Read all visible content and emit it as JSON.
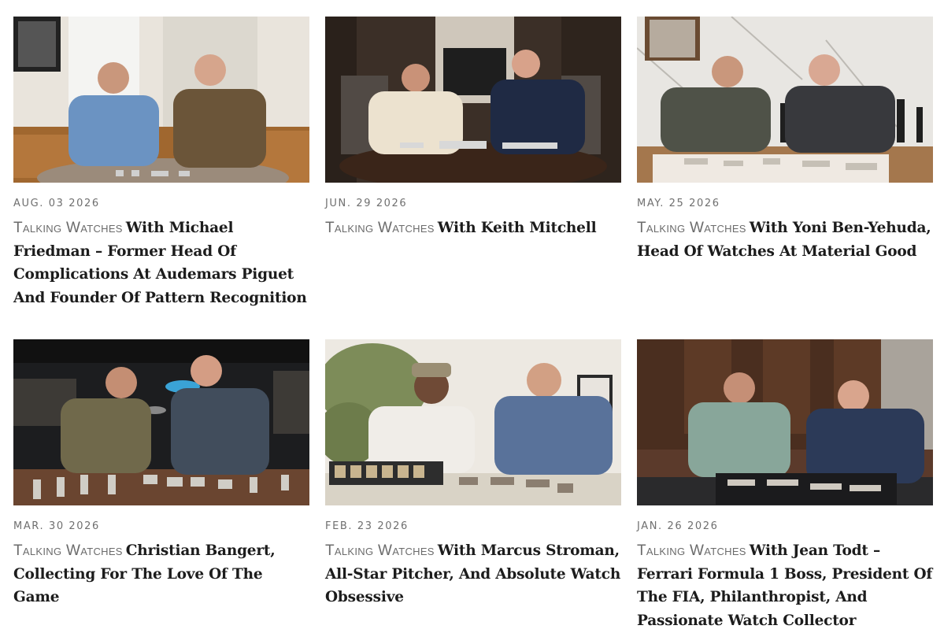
{
  "articles": [
    {
      "date": "AUG. 03 2026",
      "series": "Talking Watches",
      "title": "With Michael Friedman – Former Head Of Complications At Audemars Piguet And Founder Of Pattern Recognition"
    },
    {
      "date": "JUN. 29 2026",
      "series": "Talking Watches",
      "title": "With Keith Mitchell"
    },
    {
      "date": "MAY. 25 2026",
      "series": "Talking Watches",
      "title": "With Yoni Ben-Yehuda, Head Of Watches At Material Good"
    },
    {
      "date": "MAR. 30 2026",
      "series": "Talking Watches",
      "title": "Christian Bangert, Collecting For The Love Of The Game"
    },
    {
      "date": "FEB. 23 2026",
      "series": "Talking Watches",
      "title": "With Marcus Stroman, All-Star Pitcher, And Absolute Watch Obsessive"
    },
    {
      "date": "JAN. 26 2026",
      "series": "Talking Watches",
      "title": "With Jean Todt – Ferrari Formula 1 Boss, President Of The FIA, Philanthropist, And Passionate Watch Collector"
    }
  ],
  "colors": {
    "date": "#6f6f6f",
    "series": "#6b6b6b",
    "title": "#1c1c1c"
  }
}
